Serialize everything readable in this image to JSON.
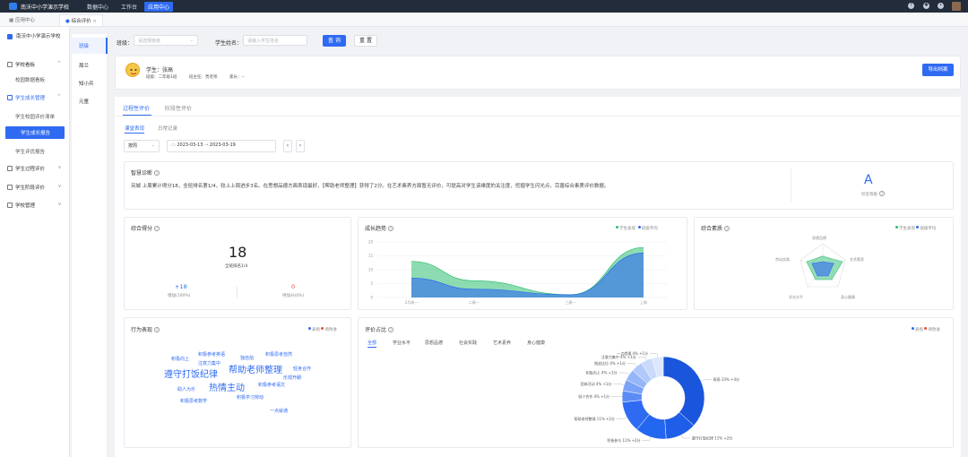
{
  "topbar": {
    "school": "南沃中小学演示学校",
    "nav": [
      "数据中心",
      "工作台",
      "应用中心"
    ],
    "icons": [
      "help-icon",
      "settings-icon",
      "bell-icon"
    ]
  },
  "tabs": [
    "应用中心",
    "综合评价"
  ],
  "sidebar": {
    "school": "南沃中小学演示学校",
    "items": [
      {
        "label": "学校看板",
        "type": "group",
        "icon": "home-icon"
      },
      {
        "label": "校园数据看板",
        "type": "sub"
      },
      {
        "label": "学生成长管理",
        "type": "group",
        "icon": "doc-icon",
        "color": "#2f6bf2"
      },
      {
        "label": "学生校园评价清单",
        "type": "sub"
      },
      {
        "label": "学生成长报告",
        "type": "sub",
        "active": true
      },
      {
        "label": "学生评优报告",
        "type": "sub"
      },
      {
        "label": "学生过程评价",
        "type": "group",
        "icon": "chart-icon"
      },
      {
        "label": "学生阶段评价",
        "type": "group",
        "icon": "flag-icon"
      },
      {
        "label": "学校管理",
        "type": "group",
        "icon": "gear-icon"
      }
    ]
  },
  "grades": [
    "班级",
    "周兰",
    "知小兵",
    "元童"
  ],
  "filter": {
    "class_label": "班级：",
    "class_placeholder": "请选择班级",
    "name_label": "学生姓名：",
    "name_placeholder": "请输入学生姓名",
    "query": "查 询",
    "reset": "重 置"
  },
  "profile": {
    "name": "学生：张高",
    "grade": "班级：二年级1班",
    "teacher": "班主任：贾老师",
    "gender": "家长：--",
    "export": "导出档案"
  },
  "tabs_main": [
    "过程性评价",
    "阶段性评价"
  ],
  "subtabs": [
    "课堂表现",
    "日常记录"
  ],
  "range": {
    "period": "按周",
    "start": "2023-03-13",
    "to": "→",
    "end": "2023-03-19"
  },
  "diagnosis": {
    "title": "智慧诊断",
    "text": "另城 上周累计得分18，全班排名第1/4，较上上周进步3名。在思想品德方面表现最好，【帮助老师整理】获得了2分。在艺术素养方面暂无评价，可提高对学生该维度的关注度，挖掘学生闪光点，完善综合素质评价数据。",
    "grade": "A",
    "grade_label": "综合等级"
  },
  "score": {
    "title": "综合得分",
    "value": "18",
    "rank": "全班排名1/4",
    "up": "+18",
    "up_label": "增加(100%)",
    "down": "0",
    "down_label": "待加分(0%)"
  },
  "trend": {
    "title": "成长趋势",
    "legend": [
      "学生表现",
      "班级平均"
    ],
    "colors": [
      "#2fbf71",
      "#2f6bf2"
    ]
  },
  "radar": {
    "title": "综合素质",
    "legend": [
      "学生表现",
      "班级平均"
    ],
    "axes": [
      "思想品德",
      "艺术素养",
      "身心健康",
      "学业水平",
      "劳动实践"
    ]
  },
  "behavior": {
    "title": "行为表现",
    "legend": [
      "表扬",
      "待改进"
    ],
    "words": [
      "积极向上",
      "积极参考英语",
      "积极思考自然",
      "遵守打饭纪律",
      "注意力集中",
      "帮助老师整理",
      "独自拍",
      "轻身合作",
      "热情主动",
      "助人为乐",
      "积极参考语文",
      "积极思考数学",
      "积极学习劳动",
      "一点就通",
      "积极思考",
      "乐观开朗"
    ]
  },
  "ratio": {
    "title": "评价占比",
    "legend": [
      "表扬",
      "待改进"
    ],
    "tabs": [
      "全部",
      "学业水平",
      "思想品德",
      "社会实践",
      "艺术素养",
      "身心健康"
    ]
  },
  "chart_data": [
    {
      "type": "area",
      "title": "成长趋势",
      "categories": [
        "2月周一",
        "二周一",
        "三周一",
        "上周"
      ],
      "ylim": [
        0,
        20
      ],
      "yticks": [
        0,
        5,
        10,
        15,
        20
      ],
      "series": [
        {
          "name": "学生表现",
          "values": [
            13,
            6,
            1,
            18
          ]
        },
        {
          "name": "班级平均",
          "values": [
            7,
            3,
            1,
            16
          ]
        }
      ]
    },
    {
      "type": "pie",
      "title": "评价占比",
      "labels": [
        "表扬 33% +4分",
        "遵守打饭纪律 11% +2分",
        "积极参与 11% +2分",
        "帮助老师整理 11% +2分",
        "轻少合作 4% +1分",
        "团体活动 4% +1分",
        "积极向上 4% +1分",
        "挑战达位 4% +1分",
        "注意力集中 4% +1分",
        "一点就通 4% +1分"
      ],
      "values": [
        33,
        11,
        11,
        11,
        4,
        4,
        4,
        4,
        4,
        4
      ]
    }
  ]
}
